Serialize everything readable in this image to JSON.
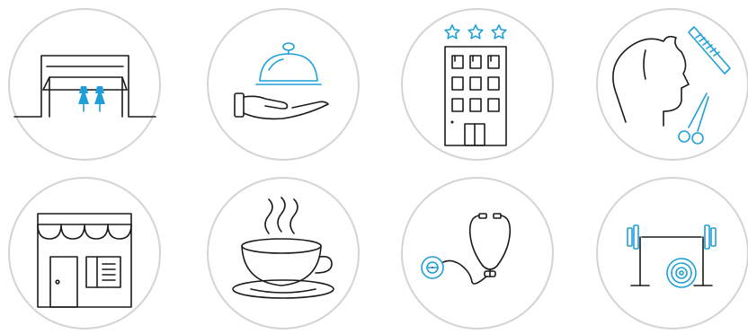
{
  "icons": [
    {
      "id": "clothing-boutique",
      "icon": "clothing-boutique-icon"
    },
    {
      "id": "room-service",
      "icon": "room-service-cloche-icon"
    },
    {
      "id": "hotel",
      "icon": "three-star-hotel-icon"
    },
    {
      "id": "barber",
      "icon": "barber-comb-scissors-icon"
    },
    {
      "id": "shop",
      "icon": "storefront-awning-icon"
    },
    {
      "id": "cafe",
      "icon": "coffee-cup-icon"
    },
    {
      "id": "medical",
      "icon": "stethoscope-icon"
    },
    {
      "id": "gym",
      "icon": "barbell-weights-icon"
    }
  ],
  "colors": {
    "accent": "#1e9fd8",
    "ink": "#1a1a1a",
    "ring": "#d4d4d4"
  }
}
